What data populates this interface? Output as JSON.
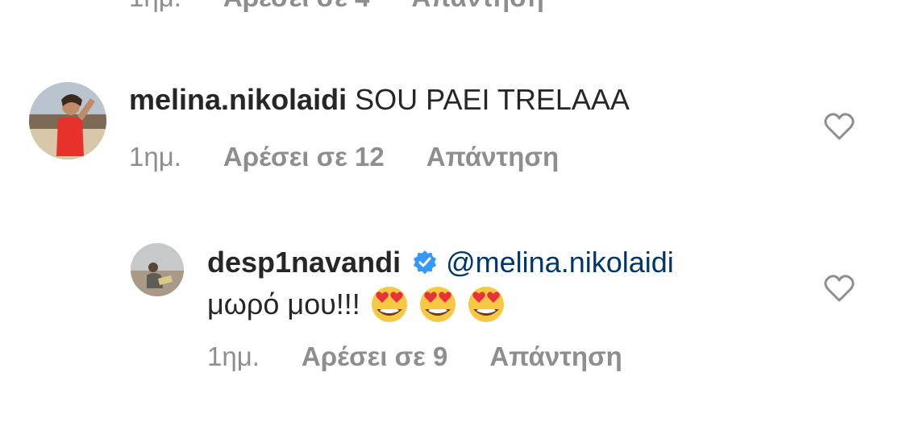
{
  "top_partial": {
    "time": "1ημ.",
    "likes": "Αρέσει σε 4",
    "reply": "Απάντηση"
  },
  "comments": [
    {
      "username": "melina.nikolaidi",
      "text": "SOU PAEI TRELAAA",
      "time": "1ημ.",
      "likes": "Αρέσει σε 12",
      "reply": "Απάντηση",
      "avatar_icon": "avatar-woman-red-swimsuit"
    },
    {
      "username": "desp1navandi",
      "verified": true,
      "mention": "@melina.nikolaidi",
      "text": "μωρό μου!!!",
      "emojis": [
        "heart-eyes-emoji",
        "heart-eyes-emoji",
        "heart-eyes-emoji"
      ],
      "time": "1ημ.",
      "likes": "Αρέσει σε 9",
      "reply": "Απάντηση",
      "avatar_icon": "avatar-person-seaside"
    }
  ],
  "colors": {
    "text": "#262626",
    "secondary": "#8e8e8e",
    "mention": "#00376b",
    "verified": "#3897f0"
  }
}
